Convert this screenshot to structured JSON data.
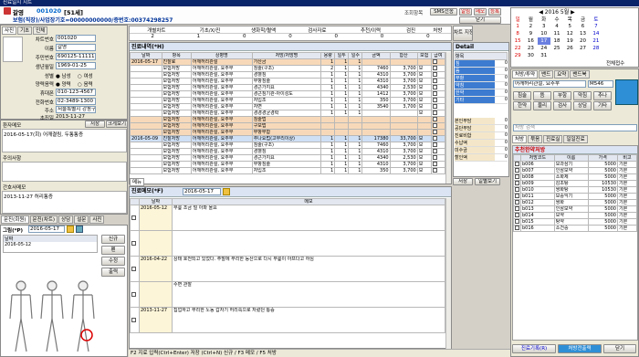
{
  "window": {
    "title": "진료일지 시트"
  },
  "patient": {
    "name": "갈영",
    "number": "001020",
    "age_sex": "[51세]",
    "insurance_line": "보험(직장)/사업장기호=00000000000/증번호:00374298257",
    "center_label": "조회항목",
    "sms": "SMS전송",
    "alerts": [
      "알림",
      "메모",
      "등록"
    ],
    "close_label": "닫기",
    "card": {
      "chart_no": "001020",
      "name": "갈영",
      "rrn": "690125-1111111",
      "birth": "1969-01-25",
      "sex_label": "성별",
      "sex_options": [
        "남성",
        "여성"
      ],
      "lunar_options": [
        "양력",
        "음력"
      ],
      "mobile": "010-123-4567",
      "home_phone": "02-3489-1300",
      "address": "서울특별시 강동구 명일동 775 쌍용",
      "first_visit": "2013-11-27",
      "labels": [
        "차트번호",
        "이름",
        "주민번호",
        "생년월일",
        "성별",
        "양력음력",
        "휴대폰",
        "전화번호",
        "주소",
        "초진일"
      ]
    },
    "tabs": [
      "사진",
      "기초",
      "인체"
    ]
  },
  "left_notes": {
    "memo_title": "환자메모",
    "memo_buttons": [
      "저장",
      "크게보기"
    ],
    "memo_text": "2016-05-17(회) 어깨결림, 두통통증",
    "memo2_title": "주의사항",
    "memo3_title": "간호사메모",
    "memo3_text": "2013-11-27 허리통증",
    "bottom_tabs": [
      "문진(회원)",
      "문진(차트)",
      "상담",
      "설문",
      "사진"
    ]
  },
  "body_chart": {
    "title": "그림(*P)",
    "date": "2016-05-17",
    "list": [
      "날짜",
      "2016-05-12"
    ],
    "side_buttons": [
      "신규",
      "펜",
      "수정",
      "출력"
    ]
  },
  "summary_bar": {
    "labels": [
      "개별차트",
      "기초/X/진",
      "생화학/혈액",
      "검사자료",
      "추천/이력",
      "검진",
      "처방",
      "차트 지정"
    ],
    "values": [
      "2",
      "1",
      "0",
      "0",
      "0",
      "0",
      "0",
      "0",
      "0",
      "1"
    ]
  },
  "tx_table": {
    "title": "진료내역(*H)",
    "columns": [
      "날짜",
      "항목",
      "상병명",
      "처방/처방명",
      "용량",
      "일투",
      "일수",
      "금액",
      "합산",
      "보험",
      "급여"
    ],
    "rows": [
      {
        "date": "2016-05-17",
        "item": "진찰료",
        "dx": "어깨허리관절",
        "rx": "가산금",
        "dose": "1",
        "daily": "1",
        "days": "1",
        "amount": "",
        "sum": "",
        "ins": "",
        "style": "row-orange"
      },
      {
        "date": "",
        "item": "보험처방",
        "dx": "어깨허리관절, 요추부",
        "rx": "침술(구조)",
        "dose": "2",
        "daily": "1",
        "days": "1",
        "amount": "7460",
        "sum": "3,700",
        "ins": "보",
        "style": ""
      },
      {
        "date": "",
        "item": "보험처방",
        "dx": "어깨허리관절, 요추부",
        "rx": "경혈침",
        "dose": "1",
        "daily": "1",
        "days": "1",
        "amount": "4310",
        "sum": "3,700",
        "ins": "보",
        "style": ""
      },
      {
        "date": "",
        "item": "보험처방",
        "dx": "어깨허리관절, 요추부",
        "rx": "부항침술",
        "dose": "1",
        "daily": "1",
        "days": "1",
        "amount": "4310",
        "sum": "3,700",
        "ins": "보",
        "style": ""
      },
      {
        "date": "",
        "item": "보험처방",
        "dx": "어깨허리관절, 요추부",
        "rx": "경근가지요",
        "dose": "1",
        "daily": "1",
        "days": "1",
        "amount": "4340",
        "sum": "2,530",
        "ins": "보",
        "style": ""
      },
      {
        "date": "",
        "item": "보험처방",
        "dx": "어깨허리관절, 요추부",
        "rx": "경근침기관-아이성도",
        "dose": "1",
        "daily": "1",
        "days": "1",
        "amount": "1412",
        "sum": "3,700",
        "ins": "보",
        "style": ""
      },
      {
        "date": "",
        "item": "보험처방",
        "dx": "어깨허리관절, 요추부",
        "rx": "자입조",
        "dose": "1",
        "daily": "1",
        "days": "1",
        "amount": "350",
        "sum": "3,700",
        "ins": "보",
        "style": ""
      },
      {
        "date": "",
        "item": "보험처방",
        "dx": "어깨허리관절, 요추부",
        "rx": "자면",
        "dose": "1",
        "daily": "1",
        "days": "1",
        "amount": "3540",
        "sum": "3,700",
        "ins": "보",
        "style": ""
      },
      {
        "date": "",
        "item": "보험처방",
        "dx": "어깨허리관절, 요추부",
        "rx": "경경경균경락",
        "dose": "1",
        "daily": "1",
        "days": "1",
        "amount": "",
        "sum": "",
        "ins": "보",
        "style": ""
      },
      {
        "date": "",
        "item": "보험처방",
        "dx": "어깨허리관절, 요추부",
        "rx": "침술법",
        "dose": "",
        "daily": "",
        "days": "",
        "amount": "",
        "sum": "",
        "ins": "",
        "style": "row-orange"
      },
      {
        "date": "",
        "item": "보험처방",
        "dx": "어깨허리관절, 요추부",
        "rx": "구보법",
        "dose": "",
        "daily": "",
        "days": "",
        "amount": "",
        "sum": "",
        "ins": "",
        "style": "row-orange"
      },
      {
        "date": "",
        "item": "보험처방",
        "dx": "어깨허리관절, 요추부",
        "rx": "부항부합",
        "dose": "",
        "daily": "",
        "days": "",
        "amount": "",
        "sum": "",
        "ins": "",
        "style": "row-orange"
      },
      {
        "date": "2016-05-09",
        "item": "진찰처방",
        "dx": "어깨허리관절, 요추부",
        "rx": "추나요법(고부리이상)",
        "dose": "1",
        "daily": "1",
        "days": "1",
        "amount": "17380",
        "sum": "33,700",
        "ins": "보",
        "style": "row-blue"
      },
      {
        "date": "",
        "item": "보험처방",
        "dx": "어깨허리관절, 요추부",
        "rx": "침술(구조)",
        "dose": "1",
        "daily": "1",
        "days": "1",
        "amount": "7460",
        "sum": "3,700",
        "ins": "보",
        "style": ""
      },
      {
        "date": "",
        "item": "보험처방",
        "dx": "어깨허리관절, 요추부",
        "rx": "경혈침",
        "dose": "1",
        "daily": "1",
        "days": "1",
        "amount": "4310",
        "sum": "3,700",
        "ins": "보",
        "style": ""
      },
      {
        "date": "",
        "item": "보험처방",
        "dx": "어깨허리관절, 요추부",
        "rx": "경근가지요",
        "dose": "1",
        "daily": "1",
        "days": "1",
        "amount": "4340",
        "sum": "2,530",
        "ins": "보",
        "style": ""
      },
      {
        "date": "",
        "item": "보험처방",
        "dx": "어깨허리관절, 요추부",
        "rx": "부항침술",
        "dose": "1",
        "daily": "1",
        "days": "1",
        "amount": "4310",
        "sum": "3,700",
        "ins": "보",
        "style": ""
      },
      {
        "date": "",
        "item": "보험처방",
        "dx": "어깨허리관절, 요추부",
        "rx": "자입조",
        "dose": "1",
        "daily": "1",
        "days": "1",
        "amount": "350",
        "sum": "3,700",
        "ins": "보",
        "style": ""
      }
    ],
    "footer_tabs": [
      "메뉴",
      "일별보기",
      "저장"
    ]
  },
  "notes_table": {
    "title": "진료메모(*F)",
    "date": "2016-05-17",
    "columns": [
      "날짜",
      "메모"
    ],
    "rows": [
      {
        "date": "2016-05-12",
        "text": "무릎 조금 덜 아파 올요"
      },
      {
        "date": "",
        "text": ""
      },
      {
        "date": "2016-04-22",
        "text": "상태 호전되고 있었다. 주말에 무리한 등산으로 다시 무릎이 아프다고 하심"
      },
      {
        "date": "",
        "text": "수면 관찰"
      },
      {
        "date": "2013-11-27",
        "text": "집업하고 무리한 노동 갑자기 허리쪽으로 저렸던 통증"
      }
    ]
  },
  "statusbar": {
    "text": "F2 지료 입력(Ctrl+Enter) 저장 (Ctrl+N) 신규 / F3 메모 / F5 처방"
  },
  "detail": {
    "title": "Detail",
    "col": "항목",
    "items": [
      "침",
      "뜸",
      "부항",
      "약침",
      "한약",
      "기타"
    ],
    "values": [
      "0",
      "0",
      "0",
      "0",
      "0",
      "0"
    ],
    "summary_labels": [
      "본인부담",
      "공단부담",
      "진료비합",
      "수납액",
      "미수금",
      "할인액"
    ]
  },
  "calendar": {
    "year_month": "2016 5월",
    "weekdays": [
      "일",
      "월",
      "화",
      "수",
      "목",
      "금",
      "토"
    ],
    "weeks": [
      [
        "1",
        "2",
        "3",
        "4",
        "5",
        "6",
        "7"
      ],
      [
        "8",
        "9",
        "10",
        "11",
        "12",
        "13",
        "14"
      ],
      [
        "15",
        "16",
        "17",
        "18",
        "19",
        "20",
        "21"
      ],
      [
        "22",
        "23",
        "24",
        "25",
        "26",
        "27",
        "28"
      ],
      [
        "29",
        "30",
        "31",
        "",
        "",
        "",
        ""
      ]
    ],
    "selected": "17",
    "side_label": "전체접수"
  },
  "right_panel": {
    "tabs": [
      "처방/투약",
      "밴드",
      "요약",
      "밴드북"
    ],
    "dx_label": "어깨허리관절, 요추부",
    "dx_code": "M546",
    "tx_buttons": [
      "침술",
      "뜸",
      "부항",
      "약침",
      "추나",
      "한약",
      "물리",
      "검사",
      "상담",
      "기타"
    ],
    "search_placeholder": "처방 검색",
    "bottom_tabs": [
      "처방",
      "묶음",
      "진료실",
      "일일진료"
    ],
    "table_title": "추천한약처방",
    "columns": [
      "처방코드",
      "이름",
      "가격",
      "비고"
    ],
    "rows": [
      {
        "code": "b006",
        "name": "모과삼기",
        "price": "5000",
        "note": "기본"
      },
      {
        "code": "b007",
        "name": "인삼보약",
        "price": "5000",
        "note": "기본"
      },
      {
        "code": "b008",
        "name": "소화제",
        "price": "5000",
        "note": "기본"
      },
      {
        "code": "b009",
        "name": "감초탕",
        "price": "10530",
        "note": "기본"
      },
      {
        "code": "b010",
        "name": "쌍화탕",
        "price": "10530",
        "note": "기본"
      },
      {
        "code": "b011",
        "name": "보중익기",
        "price": "5000",
        "note": "기본"
      },
      {
        "code": "b012",
        "name": "쌍화",
        "price": "5000",
        "note": "기본"
      },
      {
        "code": "b013",
        "name": "인삼보약",
        "price": "5000",
        "note": "기본"
      },
      {
        "code": "b014",
        "name": "보약",
        "price": "5000",
        "note": "기본"
      },
      {
        "code": "b015",
        "name": "탕약",
        "price": "5000",
        "note": "기본"
      },
      {
        "code": "b016",
        "name": "소건중",
        "price": "5000",
        "note": "기본"
      }
    ],
    "footer_buttons": [
      "진료기록(R)",
      "처방전출력",
      "닫기"
    ]
  }
}
